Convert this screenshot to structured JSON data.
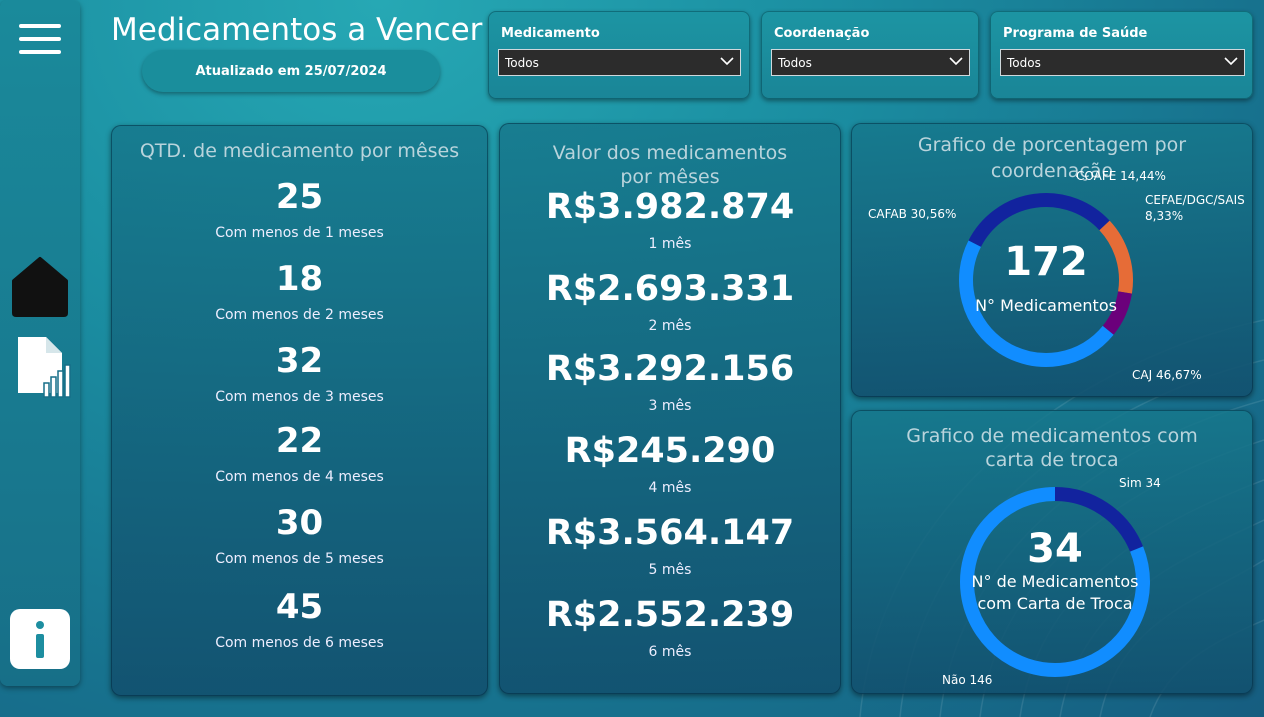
{
  "header": {
    "title": "Medicamentos a Vencer",
    "updated": "Atualizado em 25/07/2024"
  },
  "nav": {
    "items": [
      "menu-icon",
      "home-icon",
      "report-icon",
      "info-icon"
    ]
  },
  "filters": [
    {
      "label": "Medicamento",
      "value": "Todos"
    },
    {
      "label": "Coordenação",
      "value": "Todos"
    },
    {
      "label": "Programa de Saúde",
      "value": "Todos"
    }
  ],
  "qtd_panel": {
    "title": "QTD. de medicamento por mêses",
    "items": [
      {
        "value": "25",
        "label": "Com menos de 1 meses"
      },
      {
        "value": "18",
        "label": "Com menos de 2 meses"
      },
      {
        "value": "32",
        "label": "Com menos de 3 meses"
      },
      {
        "value": "22",
        "label": "Com menos de 4 meses"
      },
      {
        "value": "30",
        "label": "Com menos de 5 meses"
      },
      {
        "value": "45",
        "label": "Com menos de 6 meses"
      }
    ]
  },
  "valor_panel": {
    "title_line1": "Valor dos medicamentos",
    "title_line2": "por mêses",
    "items": [
      {
        "value": "R$3.982.874",
        "label": "1 mês"
      },
      {
        "value": "R$2.693.331",
        "label": "2 mês"
      },
      {
        "value": "R$3.292.156",
        "label": "3 mês"
      },
      {
        "value": "R$245.290",
        "label": "4 mês"
      },
      {
        "value": "R$3.564.147",
        "label": "5 mês"
      },
      {
        "value": "R$2.552.239",
        "label": "6 mês"
      }
    ]
  },
  "coord_panel": {
    "title_line1": "Grafico de porcentagem por",
    "title_line2": "coordenação",
    "center_value": "172",
    "center_label": "N° Medicamentos",
    "labels": {
      "coafe": "COAFE 14,44%",
      "cefae_1": "CEFAE/DGC/SAIS",
      "cefae_2": "8,33%",
      "cafab": "CAFAB 30,56%",
      "caj": "CAJ 46,67%"
    }
  },
  "troca_panel": {
    "title_line1": "Grafico de medicamentos com",
    "title_line2": "carta de troca",
    "center_value": "34",
    "center_label_1": "N° de Medicamentos",
    "center_label_2": "com Carta de Troca",
    "labels": {
      "sim": "Sim 34",
      "nao": "Não 146"
    }
  },
  "chart_data": [
    {
      "type": "pie",
      "title": "Grafico de porcentagem por coordenação",
      "categories": [
        "CAJ",
        "CAFAB",
        "COAFE",
        "CEFAE/DGC/SAIS"
      ],
      "values": [
        46.67,
        30.56,
        14.44,
        8.33
      ],
      "colors": [
        "#118dff",
        "#12239e",
        "#e66c37",
        "#6b007b"
      ]
    },
    {
      "type": "pie",
      "title": "Grafico de medicamentos com carta de troca",
      "categories": [
        "Sim",
        "Não"
      ],
      "values": [
        34,
        146
      ],
      "colors": [
        "#12239e",
        "#118dff"
      ]
    }
  ],
  "colors": {
    "accent_light_blue": "#118dff",
    "accent_dark_blue": "#12239e",
    "accent_orange": "#e66c37",
    "accent_purple": "#6b007b"
  }
}
